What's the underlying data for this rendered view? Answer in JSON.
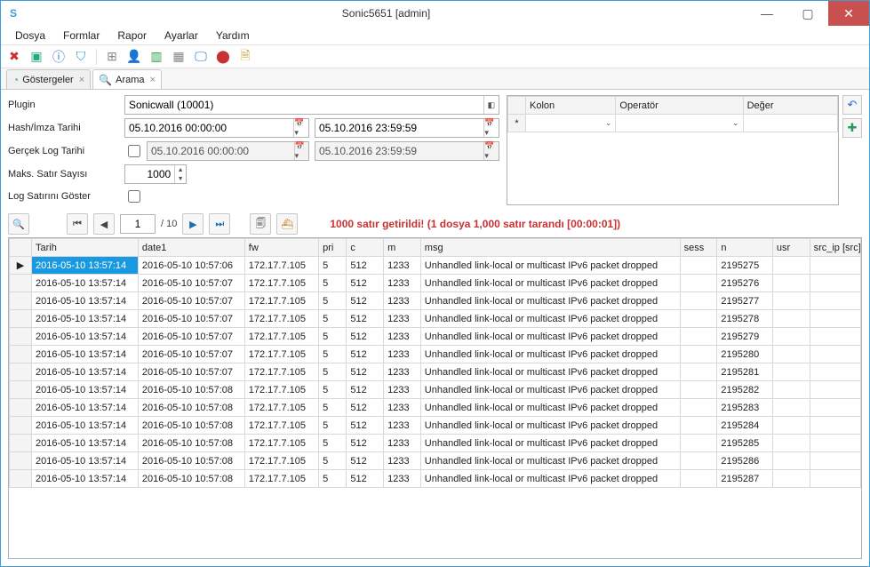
{
  "window": {
    "title": "Sonic5651 [admin]"
  },
  "menu": [
    "Dosya",
    "Formlar",
    "Rapor",
    "Ayarlar",
    "Yardım"
  ],
  "tabs": [
    {
      "label": "Göstergeler",
      "active": false
    },
    {
      "label": "Arama",
      "active": true
    }
  ],
  "form": {
    "plugin_label": "Plugin",
    "plugin_value": "Sonicwall (10001)",
    "hash_label": "Hash/İmza Tarihi",
    "hash_from": "05.10.2016 00:00:00",
    "hash_to": "05.10.2016 23:59:59",
    "real_label": "Gerçek Log Tarihi",
    "real_from": "05.10.2016 00:00:00",
    "real_to": "05.10.2016 23:59:59",
    "max_label": "Maks. Satır Sayısı",
    "max_value": "1000",
    "show_label": "Log Satırını Göster"
  },
  "filter_headers": {
    "kolon": "Kolon",
    "op": "Operatör",
    "deger": "Değer"
  },
  "nav": {
    "page": "1",
    "total": "/ 10"
  },
  "status_msg": "1000 satır getirildi! (1 dosya 1,000 satır tarandı [00:00:01])",
  "grid_headers": [
    "Tarih",
    "date1",
    "fw",
    "pri",
    "c",
    "m",
    "msg",
    "sess",
    "n",
    "usr",
    "src_ip [src]"
  ],
  "rows": [
    {
      "t": "2016-05-10 13:57:14",
      "d": "2016-05-10 10:57:06",
      "fw": "172.17.7.105",
      "p": "5",
      "c": "512",
      "m": "1233",
      "msg": "Unhandled link-local or multicast IPv6 packet dropped",
      "s": "",
      "n": "2195275",
      "u": "",
      "ip": ""
    },
    {
      "t": "2016-05-10 13:57:14",
      "d": "2016-05-10 10:57:07",
      "fw": "172.17.7.105",
      "p": "5",
      "c": "512",
      "m": "1233",
      "msg": "Unhandled link-local or multicast IPv6 packet dropped",
      "s": "",
      "n": "2195276",
      "u": "",
      "ip": ""
    },
    {
      "t": "2016-05-10 13:57:14",
      "d": "2016-05-10 10:57:07",
      "fw": "172.17.7.105",
      "p": "5",
      "c": "512",
      "m": "1233",
      "msg": "Unhandled link-local or multicast IPv6 packet dropped",
      "s": "",
      "n": "2195277",
      "u": "",
      "ip": ""
    },
    {
      "t": "2016-05-10 13:57:14",
      "d": "2016-05-10 10:57:07",
      "fw": "172.17.7.105",
      "p": "5",
      "c": "512",
      "m": "1233",
      "msg": "Unhandled link-local or multicast IPv6 packet dropped",
      "s": "",
      "n": "2195278",
      "u": "",
      "ip": ""
    },
    {
      "t": "2016-05-10 13:57:14",
      "d": "2016-05-10 10:57:07",
      "fw": "172.17.7.105",
      "p": "5",
      "c": "512",
      "m": "1233",
      "msg": "Unhandled link-local or multicast IPv6 packet dropped",
      "s": "",
      "n": "2195279",
      "u": "",
      "ip": ""
    },
    {
      "t": "2016-05-10 13:57:14",
      "d": "2016-05-10 10:57:07",
      "fw": "172.17.7.105",
      "p": "5",
      "c": "512",
      "m": "1233",
      "msg": "Unhandled link-local or multicast IPv6 packet dropped",
      "s": "",
      "n": "2195280",
      "u": "",
      "ip": ""
    },
    {
      "t": "2016-05-10 13:57:14",
      "d": "2016-05-10 10:57:07",
      "fw": "172.17.7.105",
      "p": "5",
      "c": "512",
      "m": "1233",
      "msg": "Unhandled link-local or multicast IPv6 packet dropped",
      "s": "",
      "n": "2195281",
      "u": "",
      "ip": ""
    },
    {
      "t": "2016-05-10 13:57:14",
      "d": "2016-05-10 10:57:08",
      "fw": "172.17.7.105",
      "p": "5",
      "c": "512",
      "m": "1233",
      "msg": "Unhandled link-local or multicast IPv6 packet dropped",
      "s": "",
      "n": "2195282",
      "u": "",
      "ip": ""
    },
    {
      "t": "2016-05-10 13:57:14",
      "d": "2016-05-10 10:57:08",
      "fw": "172.17.7.105",
      "p": "5",
      "c": "512",
      "m": "1233",
      "msg": "Unhandled link-local or multicast IPv6 packet dropped",
      "s": "",
      "n": "2195283",
      "u": "",
      "ip": ""
    },
    {
      "t": "2016-05-10 13:57:14",
      "d": "2016-05-10 10:57:08",
      "fw": "172.17.7.105",
      "p": "5",
      "c": "512",
      "m": "1233",
      "msg": "Unhandled link-local or multicast IPv6 packet dropped",
      "s": "",
      "n": "2195284",
      "u": "",
      "ip": ""
    },
    {
      "t": "2016-05-10 13:57:14",
      "d": "2016-05-10 10:57:08",
      "fw": "172.17.7.105",
      "p": "5",
      "c": "512",
      "m": "1233",
      "msg": "Unhandled link-local or multicast IPv6 packet dropped",
      "s": "",
      "n": "2195285",
      "u": "",
      "ip": ""
    },
    {
      "t": "2016-05-10 13:57:14",
      "d": "2016-05-10 10:57:08",
      "fw": "172.17.7.105",
      "p": "5",
      "c": "512",
      "m": "1233",
      "msg": "Unhandled link-local or multicast IPv6 packet dropped",
      "s": "",
      "n": "2195286",
      "u": "",
      "ip": ""
    },
    {
      "t": "2016-05-10 13:57:14",
      "d": "2016-05-10 10:57:08",
      "fw": "172.17.7.105",
      "p": "5",
      "c": "512",
      "m": "1233",
      "msg": "Unhandled link-local or multicast IPv6 packet dropped",
      "s": "",
      "n": "2195287",
      "u": "",
      "ip": ""
    }
  ]
}
